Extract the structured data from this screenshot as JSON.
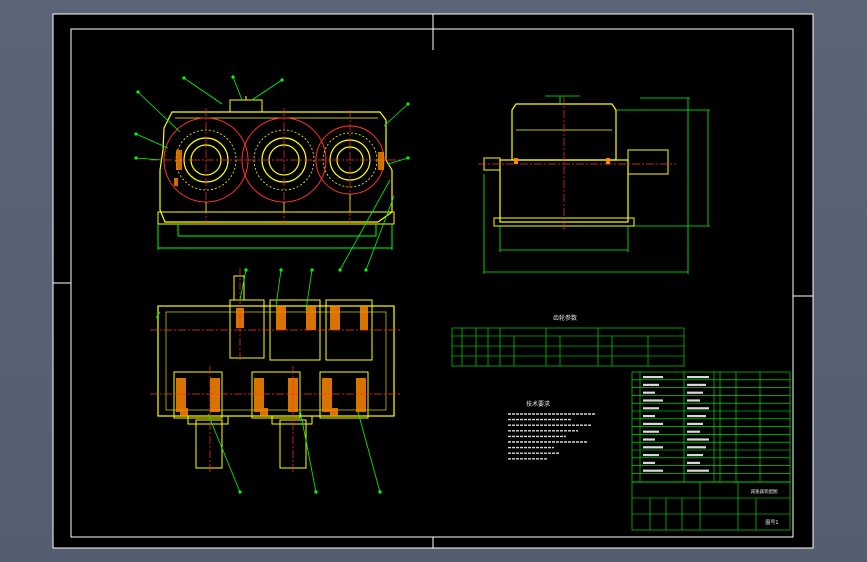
{
  "colors": {
    "background": "#5a6275",
    "canvas": "#000000",
    "frame": "#ffffff",
    "part": "#ffff00",
    "centerline": "#ff3030",
    "dimension": "#00ff00",
    "leader": "#00ff00",
    "table_line": "#00ff00",
    "text": "#e8e8e8",
    "hatch": "#ff8800"
  },
  "icons": {
    "leader_dot": "leader-dot-icon",
    "center_mark": "center-mark-icon"
  },
  "title_block": {
    "title": "减速器装配图",
    "drawing_no": "图号1"
  },
  "meshing_table": {
    "title": "齿轮参数"
  },
  "tech_requirements": {
    "title": "技术要求"
  }
}
